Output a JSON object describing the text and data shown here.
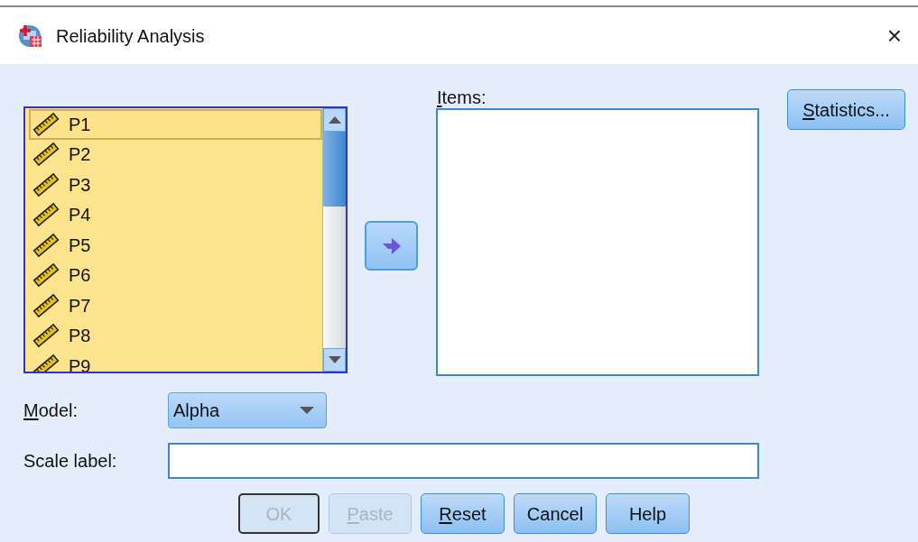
{
  "window": {
    "title": "Reliability Analysis",
    "close": "×"
  },
  "variables": [
    {
      "name": "P1",
      "selected": true
    },
    {
      "name": "P2",
      "selected": false
    },
    {
      "name": "P3",
      "selected": false
    },
    {
      "name": "P4",
      "selected": false
    },
    {
      "name": "P5",
      "selected": false
    },
    {
      "name": "P6",
      "selected": false
    },
    {
      "name": "P7",
      "selected": false
    },
    {
      "name": "P8",
      "selected": false
    },
    {
      "name": "P9",
      "selected": false
    }
  ],
  "items": {
    "label": "Items:",
    "underline_first": true
  },
  "statistics_button": {
    "label": "Statistics...",
    "underline_first": true
  },
  "model": {
    "label": "Model:",
    "underline_first": true,
    "value": "Alpha"
  },
  "scale_label": {
    "label": "Scale label:",
    "underline_first": false
  },
  "buttons": [
    {
      "label": "OK",
      "underline_first": false,
      "disabled": true,
      "default": true
    },
    {
      "label": "Paste",
      "underline_first": true,
      "disabled": true,
      "default": false
    },
    {
      "label": "Reset",
      "underline_first": true,
      "disabled": false,
      "default": false
    },
    {
      "label": "Cancel",
      "underline_first": false,
      "disabled": false,
      "default": false
    },
    {
      "label": "Help",
      "underline_first": false,
      "disabled": false,
      "default": false
    }
  ]
}
